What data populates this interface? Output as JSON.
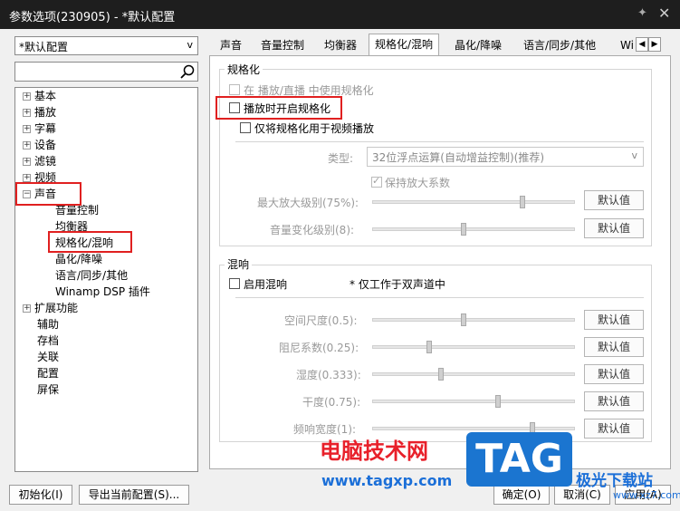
{
  "window": {
    "title": "参数选项(230905) - *默认配置",
    "pin_icon": "pin-icon",
    "close_icon": "close-icon"
  },
  "sidebar": {
    "preset": "*默认配置",
    "tree": [
      {
        "label": "基本",
        "expander": "+"
      },
      {
        "label": "播放",
        "expander": "+"
      },
      {
        "label": "字幕",
        "expander": "+"
      },
      {
        "label": "设备",
        "expander": "+"
      },
      {
        "label": "滤镜",
        "expander": "+"
      },
      {
        "label": "视频",
        "expander": "+"
      },
      {
        "label": "声音",
        "expander": "−"
      },
      {
        "label": "音量控制"
      },
      {
        "label": "均衡器"
      },
      {
        "label": "规格化/混响"
      },
      {
        "label": "晶化/降噪"
      },
      {
        "label": "语言/同步/其他"
      },
      {
        "label": "Winamp DSP 插件"
      },
      {
        "label": "扩展功能",
        "expander": "+"
      },
      {
        "label": "辅助"
      },
      {
        "label": "存档"
      },
      {
        "label": "关联"
      },
      {
        "label": "配置"
      },
      {
        "label": "屏保"
      }
    ]
  },
  "tabs": [
    "声音",
    "音量控制",
    "均衡器",
    "规格化/混响",
    "晶化/降噪",
    "语言/同步/其他",
    "Wi"
  ],
  "active_tab": "规格化/混响",
  "normalize": {
    "title": "规格化",
    "opt_stream": "在 播放/直播 中使用规格化",
    "opt_on_play": "播放时开启规格化",
    "opt_video_only": "仅将规格化用于视频播放",
    "type_label": "类型:",
    "type_value": "32位浮点运算(自动增益控制)(推荐)",
    "keep_factor": "保持放大系数",
    "max_gain_label": "最大放大级别(75%):",
    "max_gain_value": 75,
    "vol_change_label": "音量变化级别(8):",
    "vol_change_value": 8
  },
  "reverb": {
    "title": "混响",
    "enable": "启用混响",
    "note": "* 仅工作于双声道中",
    "params": [
      {
        "label": "空间尺度(0.5):",
        "value": 0.5
      },
      {
        "label": "阻尼系数(0.25):",
        "value": 0.25
      },
      {
        "label": "湿度(0.333):",
        "value": 0.333
      },
      {
        "label": "干度(0.75):",
        "value": 0.75
      },
      {
        "label": "频响宽度(1):",
        "value": 1
      }
    ]
  },
  "default_btn": "默认值",
  "footer": {
    "init": "初始化(I)",
    "export": "导出当前配置(S)...",
    "ok": "确定(O)",
    "cancel": "取消(C)",
    "apply": "应用(A)"
  },
  "watermark": {
    "cn": "电脑技术网",
    "url": "www.tagxp.com",
    "tag": "TAG",
    "site": "极光下载站",
    "site_url": "www.xz7.com"
  }
}
